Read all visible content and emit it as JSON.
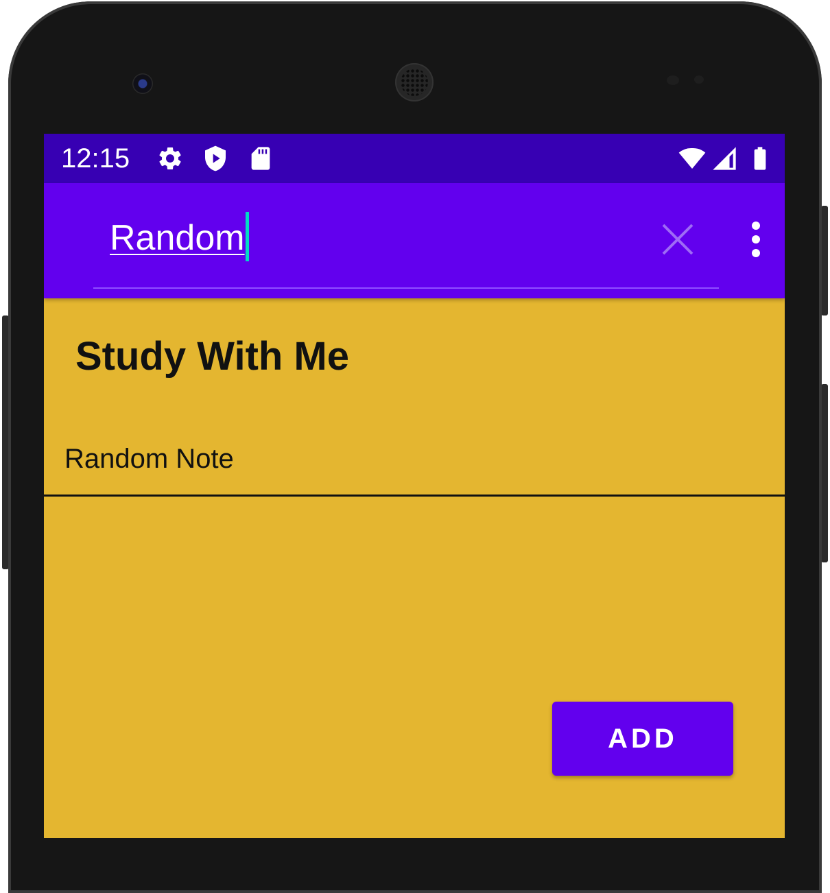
{
  "status_bar": {
    "time": "12:15",
    "left_icons": [
      "settings-icon",
      "play-protect-icon",
      "sd-card-icon"
    ],
    "right_icons": [
      "wifi-icon",
      "cell-signal-icon",
      "battery-icon"
    ],
    "background": "#3700b3"
  },
  "app_bar": {
    "search_value": "Random",
    "clear_icon": "close-icon",
    "menu_icon": "more-vert-icon",
    "background": "#6200ee"
  },
  "content": {
    "background": "#e4b630",
    "title": "Study With Me",
    "notes": [
      {
        "label": "Random Note"
      }
    ]
  },
  "add_button": {
    "label": "ADD",
    "color": "#6200ee"
  }
}
